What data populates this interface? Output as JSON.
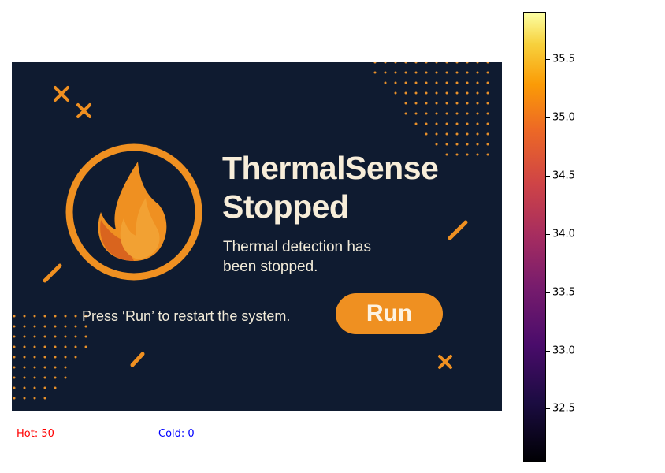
{
  "dialog": {
    "title_line1": "ThermalSense",
    "title_line2": "Stopped",
    "subtitle": "Thermal detection has been stopped.",
    "instruction": "Press ‘Run’ to restart the system.",
    "run_label": "Run",
    "flame_icon": "flame-icon",
    "colors": {
      "background": "#0f1b30",
      "accent": "#ef9021",
      "text": "#f1ead8"
    }
  },
  "status": {
    "hot": "Hot: 50",
    "cold": "Cold: 0"
  },
  "colorbar": {
    "colormap": "inferno",
    "range": [
      32.05,
      35.9
    ],
    "ticks": [
      "32.5",
      "33.0",
      "33.5",
      "34.0",
      "34.5",
      "35.0",
      "35.5"
    ]
  }
}
